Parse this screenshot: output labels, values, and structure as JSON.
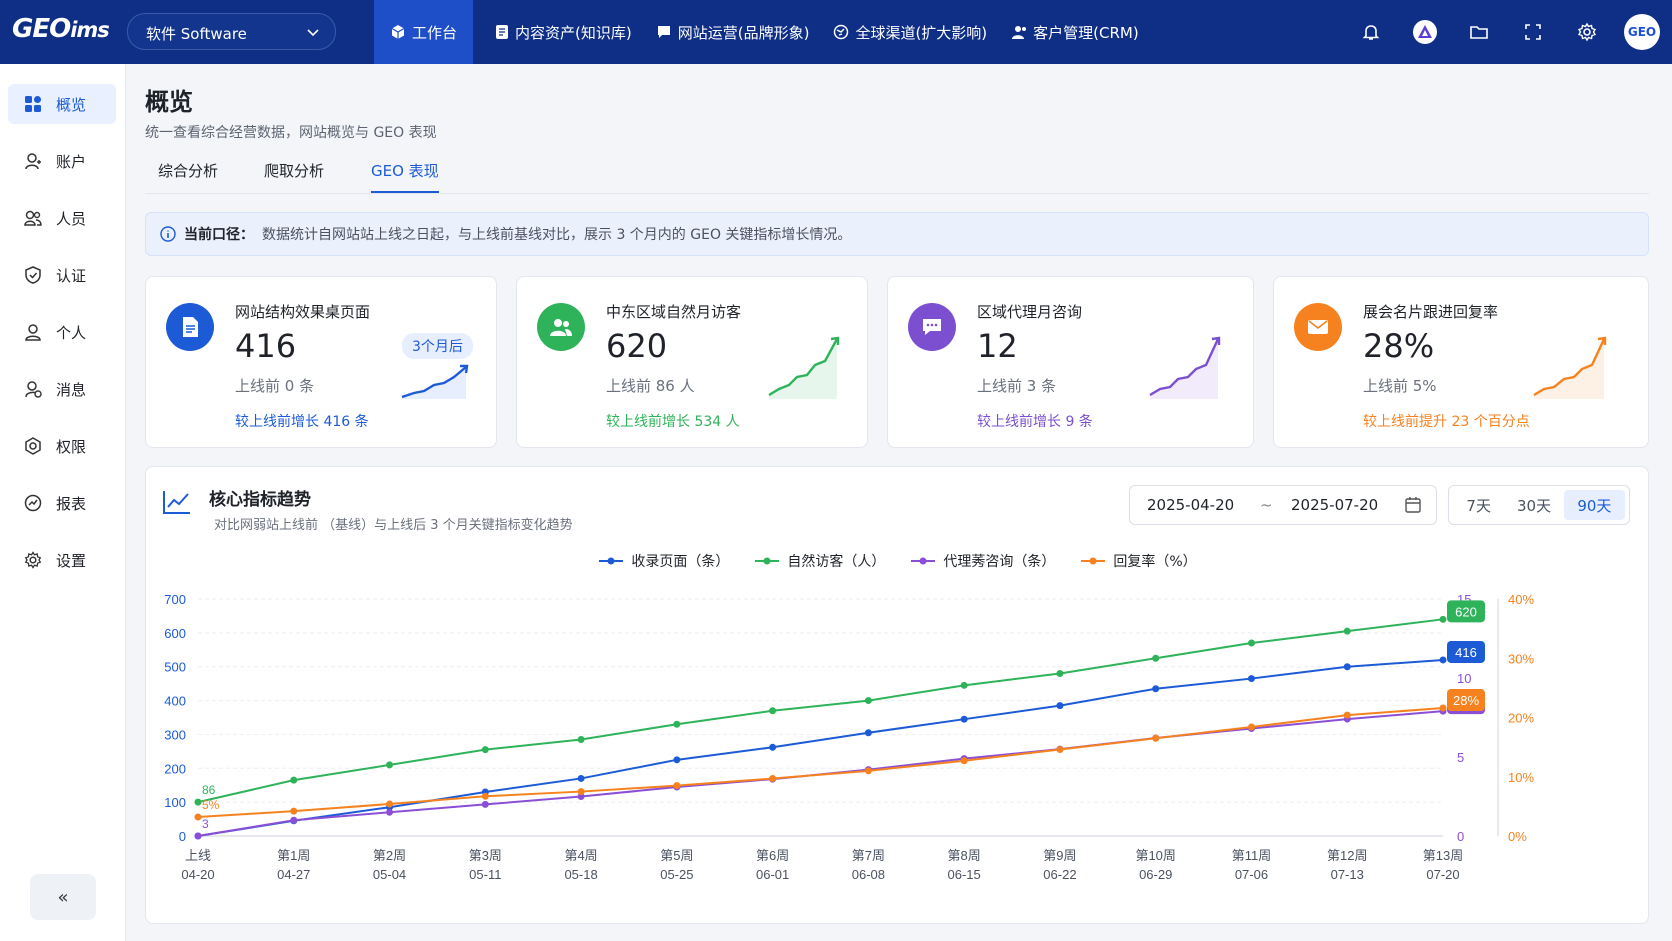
{
  "app": {
    "logo": "GEO",
    "logo_sub": "ims",
    "software_select": "软件 Software",
    "nav": [
      {
        "label": "工作台",
        "icon": "cube-icon",
        "active": true
      },
      {
        "label": "内容资产(知识库)",
        "icon": "document-icon",
        "active": false
      },
      {
        "label": "网站运营(品牌形象)",
        "icon": "chat-icon",
        "active": false
      },
      {
        "label": "全球渠道(扩大影响)",
        "icon": "globe-icon",
        "active": false
      },
      {
        "label": "客户管理(CRM)",
        "icon": "user-group-icon",
        "active": false
      }
    ],
    "avatar": "GEO"
  },
  "sidebar": {
    "items": [
      {
        "label": "概览",
        "icon": "dashboard-icon",
        "active": true
      },
      {
        "label": "账户",
        "icon": "account-icon",
        "active": false
      },
      {
        "label": "人员",
        "icon": "people-icon",
        "active": false
      },
      {
        "label": "认证",
        "icon": "shield-icon",
        "active": false
      },
      {
        "label": "个人",
        "icon": "person-icon",
        "active": false
      },
      {
        "label": "消息",
        "icon": "message-icon",
        "active": false
      },
      {
        "label": "权限",
        "icon": "permission-icon",
        "active": false
      },
      {
        "label": "报表",
        "icon": "report-icon",
        "active": false
      },
      {
        "label": "设置",
        "icon": "gear-icon",
        "active": false
      }
    ],
    "collapse": "«"
  },
  "page": {
    "title": "概览",
    "subtitle": "统一查看综合经营数据，网站概览与 GEO 表现",
    "tabs": [
      {
        "label": "综合分析",
        "active": false
      },
      {
        "label": "爬取分析",
        "active": false
      },
      {
        "label": "GEO 表现",
        "active": true
      }
    ],
    "notice_label": "当前口径：",
    "notice_text": "数据统计自网站站上线之日起，与上线前基线对比，展示 3 个月内的 GEO 关键指标增长情况。"
  },
  "cards": [
    {
      "title": "网站结构效果桌页面",
      "value": "416",
      "base": "上线前 0 条",
      "growth": "较上线前增长 416 条",
      "badge": "3个月后",
      "color": "#1d5bd6",
      "icon": "document-icon"
    },
    {
      "title": "中东区域自然月访客",
      "value": "620",
      "base": "上线前 86 人",
      "growth": "较上线前增长 534 人",
      "color": "#2fb35a",
      "icon": "users-icon"
    },
    {
      "title": "区域代理月咨询",
      "value": "12",
      "base": "上线前 3 条",
      "growth": "较上线前增长 9 条",
      "color": "#7b4fcf",
      "icon": "chat-bubble-icon"
    },
    {
      "title": "展会名片跟进回复率",
      "value": "28%",
      "base": "上线前 5%",
      "growth": "较上线前提升 23 个百分点",
      "color": "#f5821f",
      "icon": "mail-icon"
    }
  ],
  "trend": {
    "title": "核心指标趋势",
    "subtitle": "对比网弱站上线前 （基线）与上线后 3 个月关键指标变化趋势",
    "date_start": "2025-04-20",
    "date_sep": "~",
    "date_end": "2025-07-20",
    "ranges": [
      {
        "label": "7天",
        "active": false
      },
      {
        "label": "30天",
        "active": false
      },
      {
        "label": "90天",
        "active": true
      }
    ]
  },
  "chart_data": {
    "type": "line",
    "categories": [
      [
        "上线",
        "04-20"
      ],
      [
        "第1周",
        "04-27"
      ],
      [
        "第2周",
        "05-04"
      ],
      [
        "第3周",
        "05-11"
      ],
      [
        "第4周",
        "05-18"
      ],
      [
        "第5周",
        "05-25"
      ],
      [
        "第6周",
        "06-01"
      ],
      [
        "第7周",
        "06-08"
      ],
      [
        "第8周",
        "06-15"
      ],
      [
        "第9周",
        "06-22"
      ],
      [
        "第10周",
        "06-29"
      ],
      [
        "第11周",
        "07-06"
      ],
      [
        "第12周",
        "07-13"
      ],
      [
        "第13周",
        "07-20"
      ]
    ],
    "series": [
      {
        "name": "收录页面（条）",
        "color": "#1d5bd6",
        "axis": "left",
        "values": [
          0,
          45,
          85,
          130,
          170,
          225,
          262,
          305,
          345,
          385,
          435,
          465,
          500,
          520
        ],
        "end_label": "416"
      },
      {
        "name": "自然访客（人）",
        "color": "#2fb35a",
        "axis": "left",
        "values": [
          100,
          165,
          210,
          255,
          285,
          330,
          370,
          400,
          445,
          480,
          525,
          570,
          605,
          640
        ],
        "end_label": "620",
        "start_label": "86"
      },
      {
        "name": "代理莠咨询（条）",
        "color": "#8b4fd6",
        "axis": "right1",
        "values": [
          0,
          1.0,
          1.5,
          2.0,
          2.5,
          3.1,
          3.6,
          4.2,
          4.9,
          5.5,
          6.2,
          6.8,
          7.4,
          7.9
        ],
        "end_label": "12",
        "start_label": "3"
      },
      {
        "name": "回复率（%）",
        "color": "#f5821f",
        "axis": "right2",
        "values": [
          3.2,
          4.2,
          5.4,
          6.7,
          7.5,
          8.5,
          9.7,
          11.0,
          12.7,
          14.6,
          16.5,
          18.4,
          20.4,
          21.6
        ],
        "end_label": "28%",
        "start_label": "5%"
      }
    ],
    "y_left": {
      "min": 0,
      "max": 700,
      "ticks": [
        "0",
        "100",
        "200",
        "300",
        "400",
        "500",
        "600",
        "700"
      ]
    },
    "y_right1": {
      "min": 0,
      "max": 15,
      "ticks": [
        "0",
        "5",
        "10",
        "15"
      ]
    },
    "y_right2": {
      "min": 0,
      "max": 40,
      "ticks": [
        "0%",
        "10%",
        "20%",
        "30%",
        "40%"
      ]
    },
    "grid": true,
    "legend": "top-center"
  }
}
